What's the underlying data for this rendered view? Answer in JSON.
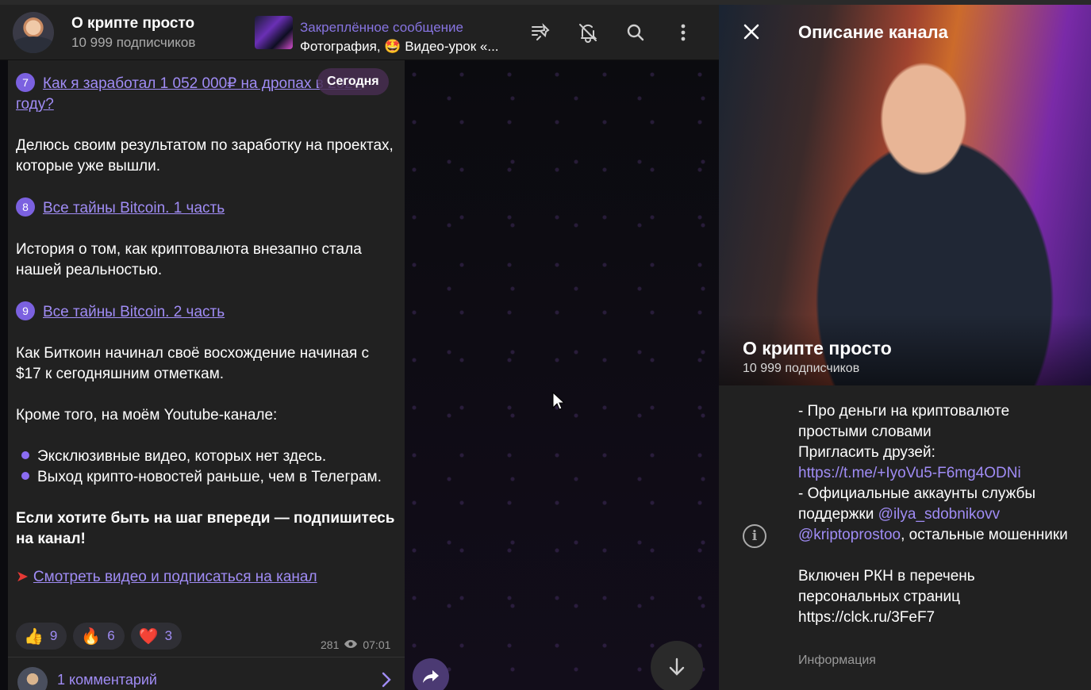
{
  "header": {
    "channel_title": "О крипте просто",
    "subscribers": "10 999 подписчиков",
    "pinned_label": "Закреплённое сообщение",
    "pinned_text": "Фотография, 🤩 Видео-урок «...",
    "icons": [
      "unpin-icon",
      "mute-bell-icon",
      "search-icon",
      "more-vertical-icon"
    ]
  },
  "date_pill": "Сегодня",
  "message": {
    "item7_num": "7",
    "item7_link": "Как я заработал 1 052 000₽ на дропах в 2024 году? ",
    "item7_desc": "Делюсь своим результатом по заработку на проектах, которые уже вышли.",
    "item8_num": "8",
    "item8_link": "Все тайны Bitcoin. 1 часть",
    "item8_desc": "История о том, как криптовалюта внезапно стала нашей реальностью.",
    "item9_num": "9",
    "item9_link": "Все тайны Bitcoin. 2 часть",
    "item9_desc": "Как Биткоин начинал своё восхождение начиная с $17 к сегодняшним отметкам.",
    "youtube_intro": "Кроме того, на моём Youtube-канале:",
    "bullet1": "Эксклюзивные видео, которых нет здесь.",
    "bullet2": "Выход крипто-новостей раньше, чем в Телеграм.",
    "cta": "Если хотите быть на шаг впереди — подпишитесь на канал!",
    "watch_link": "Смотреть видео и подписаться на канал"
  },
  "reactions": [
    {
      "emoji": "👍",
      "count": "9"
    },
    {
      "emoji": "🔥",
      "count": "6"
    },
    {
      "emoji": "❤️",
      "count": "3"
    }
  ],
  "views": "281",
  "time": "07:01",
  "comments_label": "1 комментарий",
  "panel": {
    "title": "Описание канала",
    "hero_name": "О крипте просто",
    "hero_sub": "10 999 подписчиков",
    "desc_line1": "- Про деньги на криптовалюте простыми словами",
    "desc_invite": "Пригласить друзей:",
    "desc_invite_link": "https://t.me/+IyoVu5-F6mg4ODNi",
    "desc_support": "- Официальные аккаунты службы поддержки ",
    "desc_handle1": "@ilya_sdobnikovv",
    "desc_handle2": "@kriptoprostoo",
    "desc_others": ", остальные мошенники",
    "desc_rkn": "Включен РКН в перечень персональных страниц",
    "desc_rkn_link": "https://clck.ru/3FeF7",
    "caption": "Информация"
  },
  "colors": {
    "accent": "#8774e1",
    "link": "#a08cf5",
    "bubble": "#212121",
    "header": "#212121"
  }
}
